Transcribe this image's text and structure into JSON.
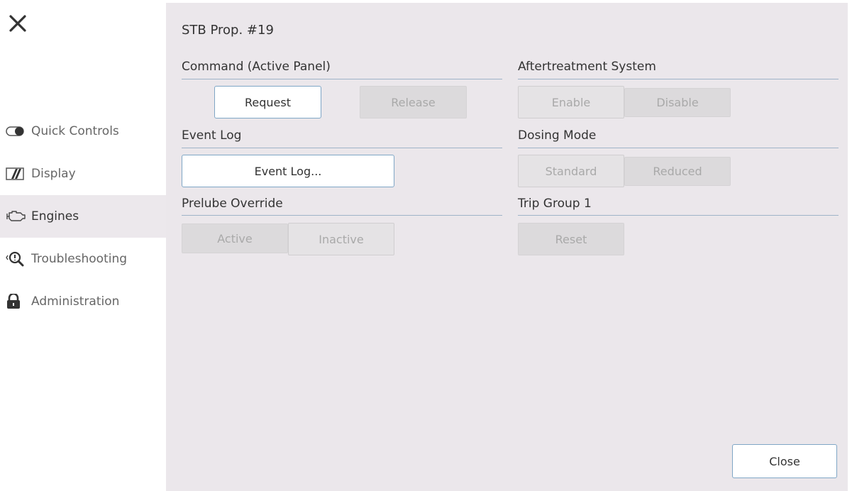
{
  "sidebar": {
    "close_icon": "close-icon",
    "items": [
      {
        "label": "Quick Controls",
        "icon": "toggle-icon"
      },
      {
        "label": "Display",
        "icon": "display-icon"
      },
      {
        "label": "Engines",
        "icon": "engine-icon",
        "active": true
      },
      {
        "label": "Troubleshooting",
        "icon": "troubleshooting-icon"
      },
      {
        "label": "Administration",
        "icon": "lock-icon"
      }
    ]
  },
  "panel": {
    "title": "STB Prop. #19",
    "command": {
      "label": "Command (Active Panel)",
      "request": "Request",
      "release": "Release"
    },
    "event_log": {
      "label": "Event Log",
      "button": "Event Log..."
    },
    "prelube": {
      "label": "Prelube Override",
      "active": "Active",
      "inactive": "Inactive"
    },
    "aftertreatment": {
      "label": "Aftertreatment System",
      "enable": "Enable",
      "disable": "Disable"
    },
    "dosing": {
      "label": "Dosing Mode",
      "standard": "Standard",
      "reduced": "Reduced"
    },
    "trip_group": {
      "label": "Trip Group 1",
      "reset": "Reset"
    },
    "close": "Close"
  },
  "colors": {
    "accent": "#7fa6c6",
    "panel_bg": "#ebe7eb",
    "divider": "#9fb3c8"
  }
}
